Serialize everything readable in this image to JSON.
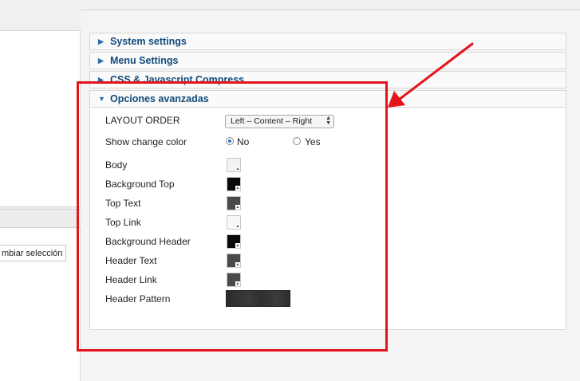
{
  "sidebar": {
    "change_selection_button": "mbiar selección"
  },
  "panels": [
    {
      "label": "System settings",
      "expanded": false
    },
    {
      "label": "Menu Settings",
      "expanded": false
    },
    {
      "label": "CSS & Javascript Compress",
      "expanded": false
    },
    {
      "label": "Opciones avanzadas",
      "expanded": true
    }
  ],
  "advanced": {
    "layout_order": {
      "label": "LAYOUT ORDER",
      "selected": "Left – Content – Right"
    },
    "show_change_color": {
      "label": "Show change color",
      "options": [
        {
          "label": "No",
          "checked": true
        },
        {
          "label": "Yes",
          "checked": false
        }
      ]
    },
    "colors": [
      {
        "label": "Body",
        "color": "#f2f2f2"
      },
      {
        "label": "Background Top",
        "color": "#0a0a0a"
      },
      {
        "label": "Top Text",
        "color": "#4a4a4a"
      },
      {
        "label": "Top Link",
        "color": "#f8f8f8"
      },
      {
        "label": "Background Header",
        "color": "#0a0a0a"
      },
      {
        "label": "Header Text",
        "color": "#4a4a4a"
      },
      {
        "label": "Header Link",
        "color": "#4a4a4a"
      }
    ],
    "header_pattern": {
      "label": "Header Pattern"
    }
  },
  "annotation": {
    "color": "#e4141a"
  }
}
